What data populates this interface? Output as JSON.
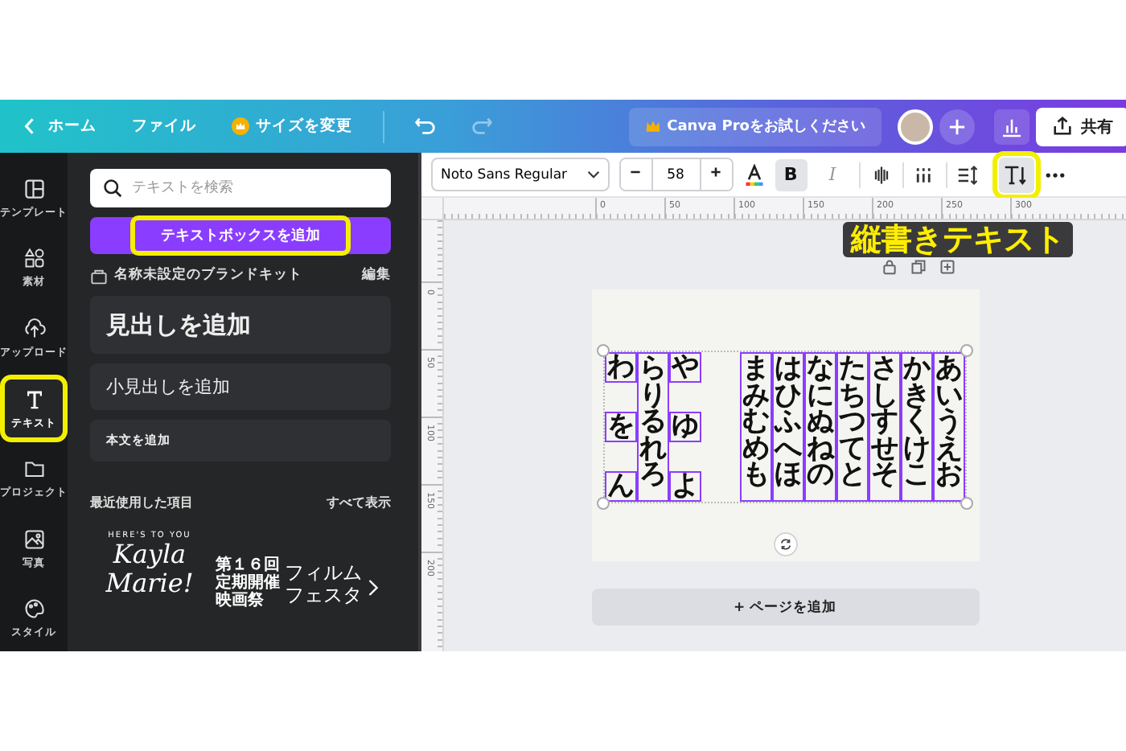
{
  "top_bar": {
    "back": "ホーム",
    "file": "ファイル",
    "resize": "サイズを変更",
    "pro_button": "Canva Proをお試しください",
    "share_button": "共有"
  },
  "toolbar": {
    "font": "Noto Sans Regular",
    "size": "58",
    "bold_label": "B",
    "italic_label": "I",
    "bold": true,
    "italic": false,
    "vertical_text": {
      "selected": true,
      "highlighted": true
    }
  },
  "annotation": "縦書きテキスト",
  "rail": [
    {
      "kind": "template",
      "label": "テンプレート",
      "selected": false,
      "highlighted": false
    },
    {
      "kind": "elements",
      "label": "素材",
      "selected": false,
      "highlighted": false
    },
    {
      "kind": "upload",
      "label": "アップロード",
      "selected": false,
      "highlighted": false
    },
    {
      "kind": "text",
      "label": "テキスト",
      "selected": true,
      "highlighted": true
    },
    {
      "kind": "project",
      "label": "プロジェクト",
      "selected": false,
      "highlighted": false
    },
    {
      "kind": "photo",
      "label": "写真",
      "selected": false,
      "highlighted": false
    },
    {
      "kind": "style",
      "label": "スタイル",
      "selected": false,
      "highlighted": false
    }
  ],
  "panel": {
    "search": {
      "placeholder": "テキストを検索"
    },
    "add_textbox": {
      "label": "テキストボックスを追加",
      "highlighted": true
    },
    "brand_kit": "名称未設定のブランドキット",
    "edit": "編集",
    "styles": [
      {
        "kind": "heading",
        "label": "見出しを追加"
      },
      {
        "kind": "subheading",
        "label": "小見出しを追加"
      },
      {
        "kind": "body",
        "label": "本文を追加"
      }
    ],
    "recent_title": "最近使用した項目",
    "see_all": "すべて表示",
    "templates": [
      {
        "kind": "script",
        "lines": [
          "HERE'S TO YOU",
          "Kayla",
          "Marie!"
        ]
      },
      {
        "kind": "festival",
        "small": [
          "第１６回",
          "定期開催",
          "映画祭"
        ],
        "lines": [
          "フィルム",
          "フェスタ"
        ]
      }
    ]
  },
  "ruler_h": [
    "0",
    "50",
    "100",
    "150",
    "200",
    "250",
    "300"
  ],
  "ruler_v": [
    "0",
    "50",
    "100",
    "150",
    "200"
  ],
  "canvas": {
    "columns": [
      {
        "kind": "spaced",
        "chars": [
          "わ",
          "を",
          "ん"
        ]
      },
      {
        "kind": "full",
        "text": "らりるれろ"
      },
      {
        "kind": "spaced",
        "chars": [
          "や",
          "ゆ",
          "よ"
        ]
      },
      {
        "kind": "gap"
      },
      {
        "kind": "full",
        "text": "まみむめも"
      },
      {
        "kind": "full",
        "text": "はひふへほ"
      },
      {
        "kind": "full",
        "text": "なにぬねの"
      },
      {
        "kind": "full",
        "text": "たちつてと"
      },
      {
        "kind": "full",
        "text": "さしすせそ"
      },
      {
        "kind": "full",
        "text": "かきくけこ"
      },
      {
        "kind": "full",
        "text": "あいうえお"
      }
    ],
    "add_page": "+ ページを追加"
  }
}
